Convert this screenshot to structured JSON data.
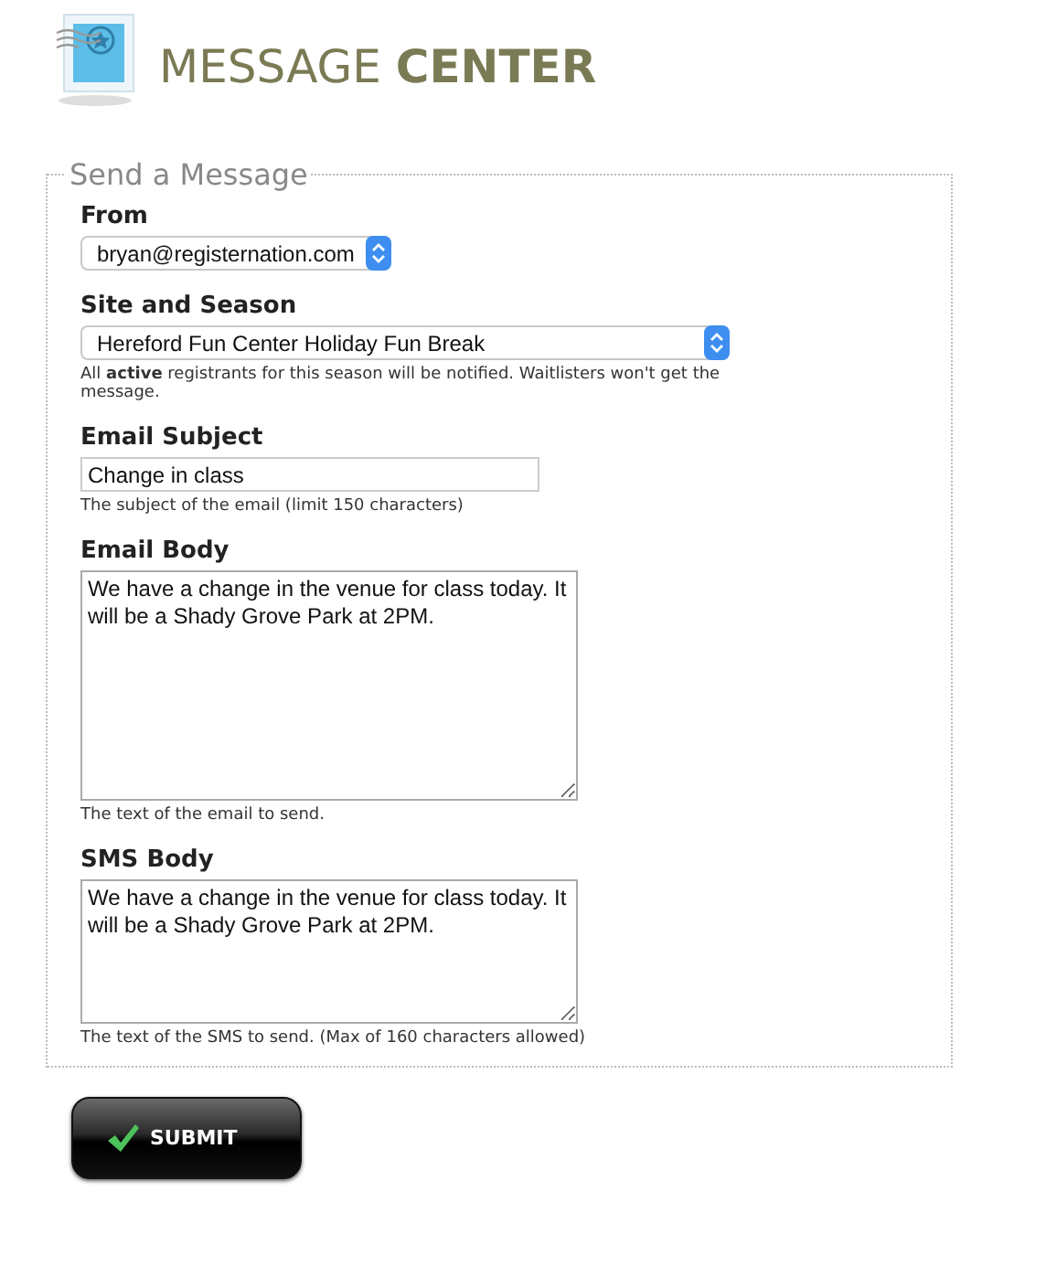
{
  "header": {
    "title": "MESSAGE **CENTER**"
  },
  "form": {
    "legend": "Send a Message",
    "fields": [
      {
        "kind": "select",
        "label": "From",
        "value": "bryan@registernation.com"
      },
      {
        "kind": "select",
        "label": "Site and Season",
        "value": "Hereford Fun Center Holiday Fun Break",
        "hint": "All **active** registrants for this season will be notified. Waitlisters won't get the message."
      },
      {
        "kind": "text",
        "label": "Email Subject",
        "value": "Change in class",
        "hint": "The subject of the email (limit 150 characters)"
      },
      {
        "kind": "textarea",
        "label": "Email Body",
        "value": "We have a change in the venue for class today. It will be a Shady Grove Park at 2PM.",
        "hint": "The text of the email to send."
      },
      {
        "kind": "textarea",
        "label": "SMS Body",
        "value": "We have a change in the venue for class today. It will be a Shady Grove Park at 2PM.",
        "hint": "The text of the SMS to send. (Max of 160 characters allowed)"
      }
    ]
  },
  "submit": {
    "label": "SUBMIT"
  }
}
